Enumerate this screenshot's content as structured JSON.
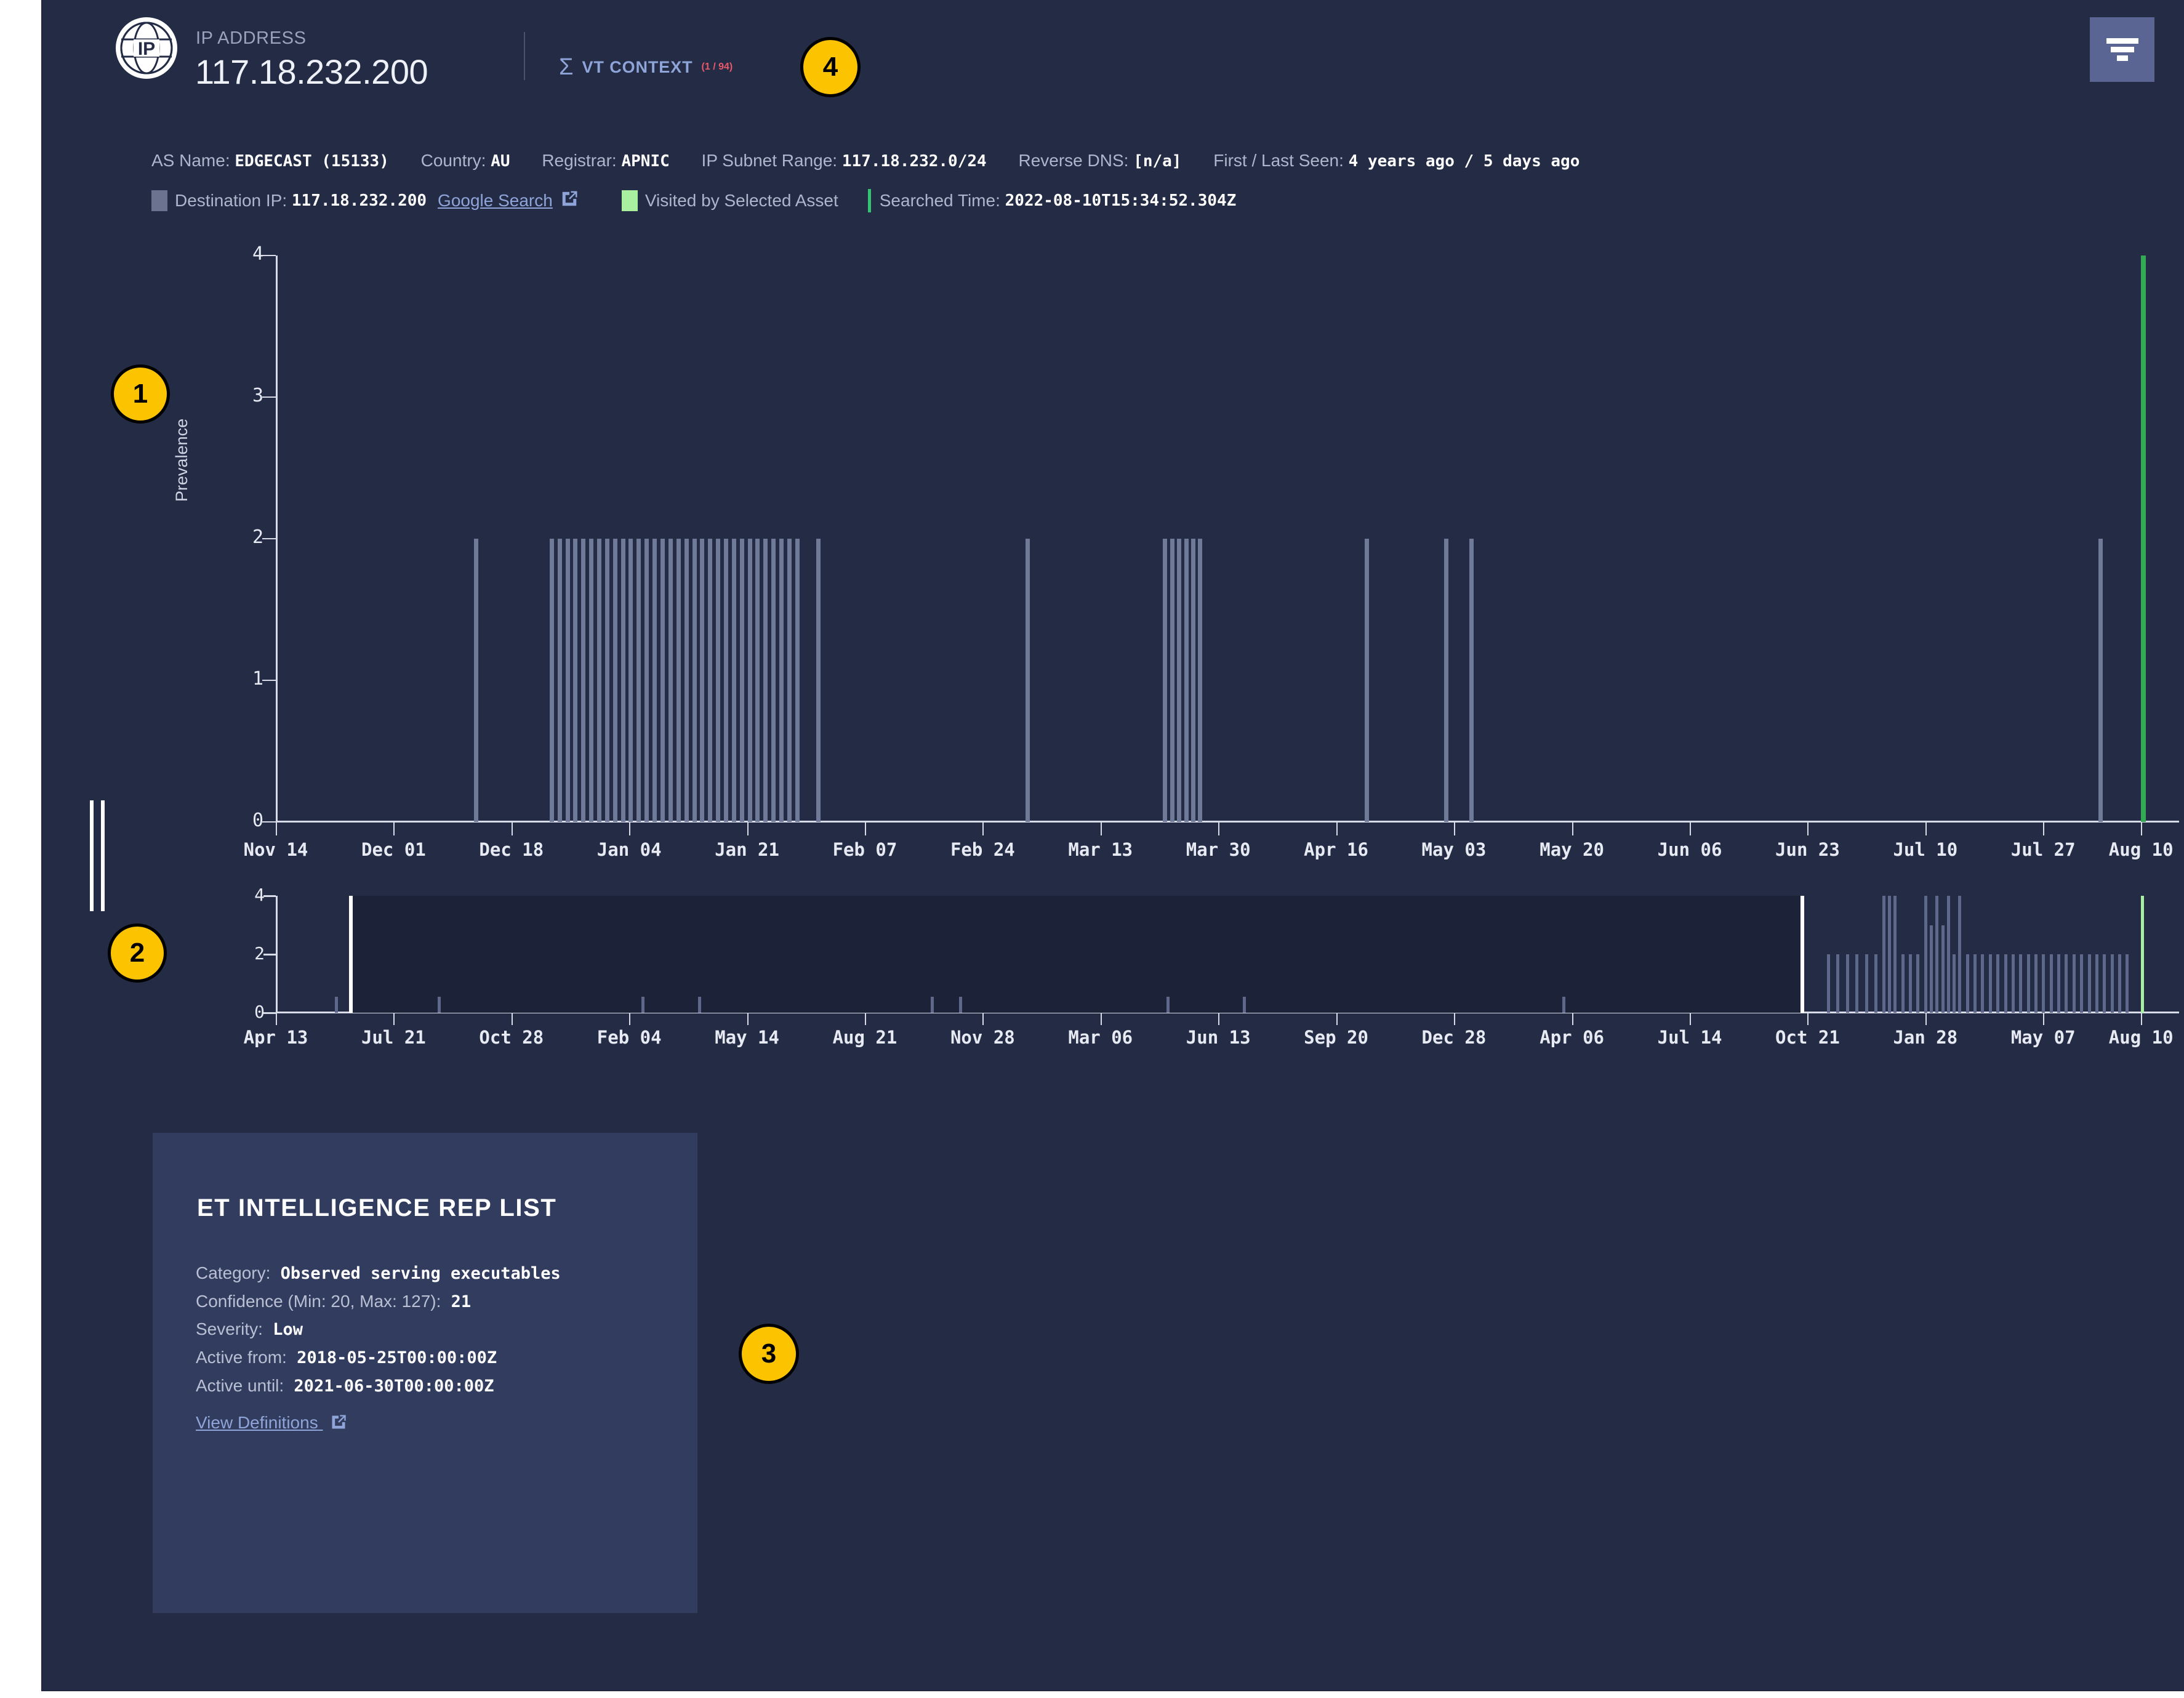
{
  "header": {
    "ip_label": "IP ADDRESS",
    "ip_value": "117.18.232.200",
    "vt_sigma_icon": "sigma-icon",
    "vt_label": "VT CONTEXT",
    "vt_count": "(1 / 94)",
    "filter_icon": "filter-icon",
    "ip_badge_icon": "ip-globe-icon"
  },
  "meta": {
    "as_name_label": "AS Name:",
    "as_name_value": "EDGECAST (15133)",
    "country_label": "Country:",
    "country_value": "AU",
    "registrar_label": "Registrar:",
    "registrar_value": "APNIC",
    "subnet_label": "IP Subnet Range:",
    "subnet_value": "117.18.232.0/24",
    "rdns_label": "Reverse DNS:",
    "rdns_value": "[n/a]",
    "seen_label": "First / Last Seen:",
    "seen_value": "4 years ago / 5 days ago",
    "dest_label": "Destination IP:",
    "dest_value": "117.18.232.200",
    "google_search": "Google Search",
    "visited_legend": "Visited by Selected Asset",
    "searched_label": "Searched Time:",
    "searched_value": "2022-08-10T15:34:52.304Z"
  },
  "card": {
    "title": "ET INTELLIGENCE REP LIST",
    "rows": [
      {
        "label": "Category:",
        "value": "Observed serving executables"
      },
      {
        "label": "Confidence (Min: 20, Max: 127):",
        "value": "21"
      },
      {
        "label": "Severity:",
        "value": "Low"
      },
      {
        "label": "Active from:",
        "value": "2018-05-25T00:00:00Z"
      },
      {
        "label": "Active until:",
        "value": "2021-06-30T00:00:00Z"
      }
    ],
    "link": "View Definitions"
  },
  "callouts": [
    {
      "id": "1",
      "target": "prevalence-chart"
    },
    {
      "id": "2",
      "target": "timeline-brush-chart"
    },
    {
      "id": "3",
      "target": "et-intelligence-card"
    },
    {
      "id": "4",
      "target": "vt-context-link"
    }
  ],
  "colors": {
    "panel_bg": "#232b45",
    "card_bg": "#323c5e",
    "accent_link": "#8fa4d8",
    "alert_red": "#e8596a",
    "visited_green": "#a8f0a0",
    "bar_grey": "#6f7a99",
    "bar_green": "#35a853",
    "callout_yellow": "#fbc300",
    "filter_btn": "#5b6593"
  },
  "chart_data": [
    {
      "type": "bar",
      "id": "prevalence-chart",
      "title": "",
      "xlabel": "",
      "ylabel": "Prevalence",
      "ylim": [
        0,
        4
      ],
      "yticks": [
        0,
        1,
        2,
        3,
        4
      ],
      "grid": false,
      "legend": [
        "Destination IP: 117.18.232.200",
        "Visited by Selected Asset"
      ],
      "xticks": [
        "Nov 14",
        "Dec 01",
        "Dec 18",
        "Jan 04",
        "Jan 21",
        "Feb 07",
        "Feb 24",
        "Mar 13",
        "Mar 30",
        "Apr 16",
        "May 03",
        "May 20",
        "Jun 06",
        "Jun 23",
        "Jul 10",
        "Jul 27",
        "Aug 10"
      ],
      "xtick_positions": [
        0.0,
        0.0619,
        0.1238,
        0.1857,
        0.2476,
        0.3095,
        0.3714,
        0.4333,
        0.4952,
        0.5571,
        0.619,
        0.681,
        0.7429,
        0.8048,
        0.8667,
        0.9286,
        0.98
      ],
      "series": [
        {
          "name": "Destination IP",
          "color": "#6f7a99",
          "points": [
            {
              "x": 0.104,
              "y": 2
            },
            {
              "x": 0.144,
              "y": 2
            },
            {
              "x": 0.148,
              "y": 2
            },
            {
              "x": 0.1522,
              "y": 2
            },
            {
              "x": 0.1563,
              "y": 2
            },
            {
              "x": 0.1604,
              "y": 2
            },
            {
              "x": 0.1646,
              "y": 2
            },
            {
              "x": 0.1688,
              "y": 2
            },
            {
              "x": 0.1729,
              "y": 2
            },
            {
              "x": 0.1771,
              "y": 2
            },
            {
              "x": 0.1813,
              "y": 2
            },
            {
              "x": 0.1854,
              "y": 2
            },
            {
              "x": 0.1896,
              "y": 2
            },
            {
              "x": 0.1938,
              "y": 2
            },
            {
              "x": 0.1979,
              "y": 2
            },
            {
              "x": 0.2021,
              "y": 2
            },
            {
              "x": 0.2063,
              "y": 2
            },
            {
              "x": 0.2104,
              "y": 2
            },
            {
              "x": 0.2146,
              "y": 2
            },
            {
              "x": 0.2188,
              "y": 2
            },
            {
              "x": 0.2229,
              "y": 2
            },
            {
              "x": 0.2271,
              "y": 2
            },
            {
              "x": 0.2313,
              "y": 2
            },
            {
              "x": 0.2354,
              "y": 2
            },
            {
              "x": 0.2396,
              "y": 2
            },
            {
              "x": 0.2438,
              "y": 2
            },
            {
              "x": 0.2479,
              "y": 2
            },
            {
              "x": 0.2521,
              "y": 2
            },
            {
              "x": 0.2563,
              "y": 2
            },
            {
              "x": 0.2604,
              "y": 2
            },
            {
              "x": 0.2646,
              "y": 2
            },
            {
              "x": 0.2688,
              "y": 2
            },
            {
              "x": 0.2729,
              "y": 2
            },
            {
              "x": 0.284,
              "y": 2
            },
            {
              "x": 0.394,
              "y": 2
            },
            {
              "x": 0.466,
              "y": 2
            },
            {
              "x": 0.47,
              "y": 2
            },
            {
              "x": 0.4735,
              "y": 2
            },
            {
              "x": 0.4775,
              "y": 2
            },
            {
              "x": 0.481,
              "y": 2
            },
            {
              "x": 0.4845,
              "y": 2
            },
            {
              "x": 0.572,
              "y": 2
            },
            {
              "x": 0.614,
              "y": 2
            },
            {
              "x": 0.627,
              "y": 2
            },
            {
              "x": 0.9575,
              "y": 2
            }
          ]
        },
        {
          "name": "Visited by Selected Asset",
          "color": "#35a853",
          "points": [
            {
              "x": 0.98,
              "y": 4
            }
          ]
        }
      ]
    },
    {
      "type": "bar",
      "id": "timeline-brush-chart",
      "title": "",
      "xlabel": "",
      "ylabel": "",
      "ylim": [
        0,
        4
      ],
      "yticks": [
        0,
        2,
        4
      ],
      "grid": false,
      "brush_selection": [
        0.0395,
        0.802
      ],
      "xticks": [
        "Apr 13",
        "Jul 21",
        "Oct 28",
        "Feb 04",
        "May 14",
        "Aug 21",
        "Nov 28",
        "Mar 06",
        "Jun 13",
        "Sep 20",
        "Dec 28",
        "Apr 06",
        "Jul 14",
        "Oct 21",
        "Jan 28",
        "May 07",
        "Aug 10"
      ],
      "xtick_positions": [
        0.0,
        0.0619,
        0.1238,
        0.1857,
        0.2476,
        0.3095,
        0.3714,
        0.4333,
        0.4952,
        0.5571,
        0.619,
        0.681,
        0.7429,
        0.8048,
        0.8667,
        0.9286,
        0.98
      ],
      "series": [
        {
          "name": "Destination IP",
          "color": "#5e688a",
          "points": [
            {
              "x": 0.031,
              "y": 0.55
            },
            {
              "x": 0.085,
              "y": 0.55
            },
            {
              "x": 0.192,
              "y": 0.55
            },
            {
              "x": 0.222,
              "y": 0.55
            },
            {
              "x": 0.344,
              "y": 0.55
            },
            {
              "x": 0.359,
              "y": 0.55
            },
            {
              "x": 0.468,
              "y": 0.55
            },
            {
              "x": 0.508,
              "y": 0.55
            },
            {
              "x": 0.676,
              "y": 0.55
            },
            {
              "x": 0.815,
              "y": 2
            },
            {
              "x": 0.82,
              "y": 2
            },
            {
              "x": 0.825,
              "y": 2
            },
            {
              "x": 0.83,
              "y": 2
            },
            {
              "x": 0.835,
              "y": 2
            },
            {
              "x": 0.84,
              "y": 2
            },
            {
              "x": 0.844,
              "y": 4
            },
            {
              "x": 0.847,
              "y": 4
            },
            {
              "x": 0.85,
              "y": 4
            },
            {
              "x": 0.854,
              "y": 2
            },
            {
              "x": 0.858,
              "y": 2
            },
            {
              "x": 0.862,
              "y": 2
            },
            {
              "x": 0.866,
              "y": 4
            },
            {
              "x": 0.869,
              "y": 3
            },
            {
              "x": 0.872,
              "y": 4
            },
            {
              "x": 0.875,
              "y": 3
            },
            {
              "x": 0.878,
              "y": 4
            },
            {
              "x": 0.881,
              "y": 2
            },
            {
              "x": 0.884,
              "y": 4
            },
            {
              "x": 0.888,
              "y": 2
            },
            {
              "x": 0.892,
              "y": 2
            },
            {
              "x": 0.896,
              "y": 2
            },
            {
              "x": 0.9,
              "y": 2
            },
            {
              "x": 0.904,
              "y": 2
            },
            {
              "x": 0.908,
              "y": 2
            },
            {
              "x": 0.912,
              "y": 2
            },
            {
              "x": 0.916,
              "y": 2
            },
            {
              "x": 0.92,
              "y": 2
            },
            {
              "x": 0.924,
              "y": 2
            },
            {
              "x": 0.928,
              "y": 2
            },
            {
              "x": 0.932,
              "y": 2
            },
            {
              "x": 0.936,
              "y": 2
            },
            {
              "x": 0.94,
              "y": 2
            },
            {
              "x": 0.944,
              "y": 2
            },
            {
              "x": 0.948,
              "y": 2
            },
            {
              "x": 0.952,
              "y": 2
            },
            {
              "x": 0.956,
              "y": 2
            },
            {
              "x": 0.96,
              "y": 2
            },
            {
              "x": 0.964,
              "y": 2
            },
            {
              "x": 0.968,
              "y": 2
            },
            {
              "x": 0.972,
              "y": 2
            }
          ]
        },
        {
          "name": "Visited by Selected Asset",
          "color": "#a8f0a0",
          "points": [
            {
              "x": 0.98,
              "y": 4
            }
          ]
        }
      ]
    }
  ]
}
